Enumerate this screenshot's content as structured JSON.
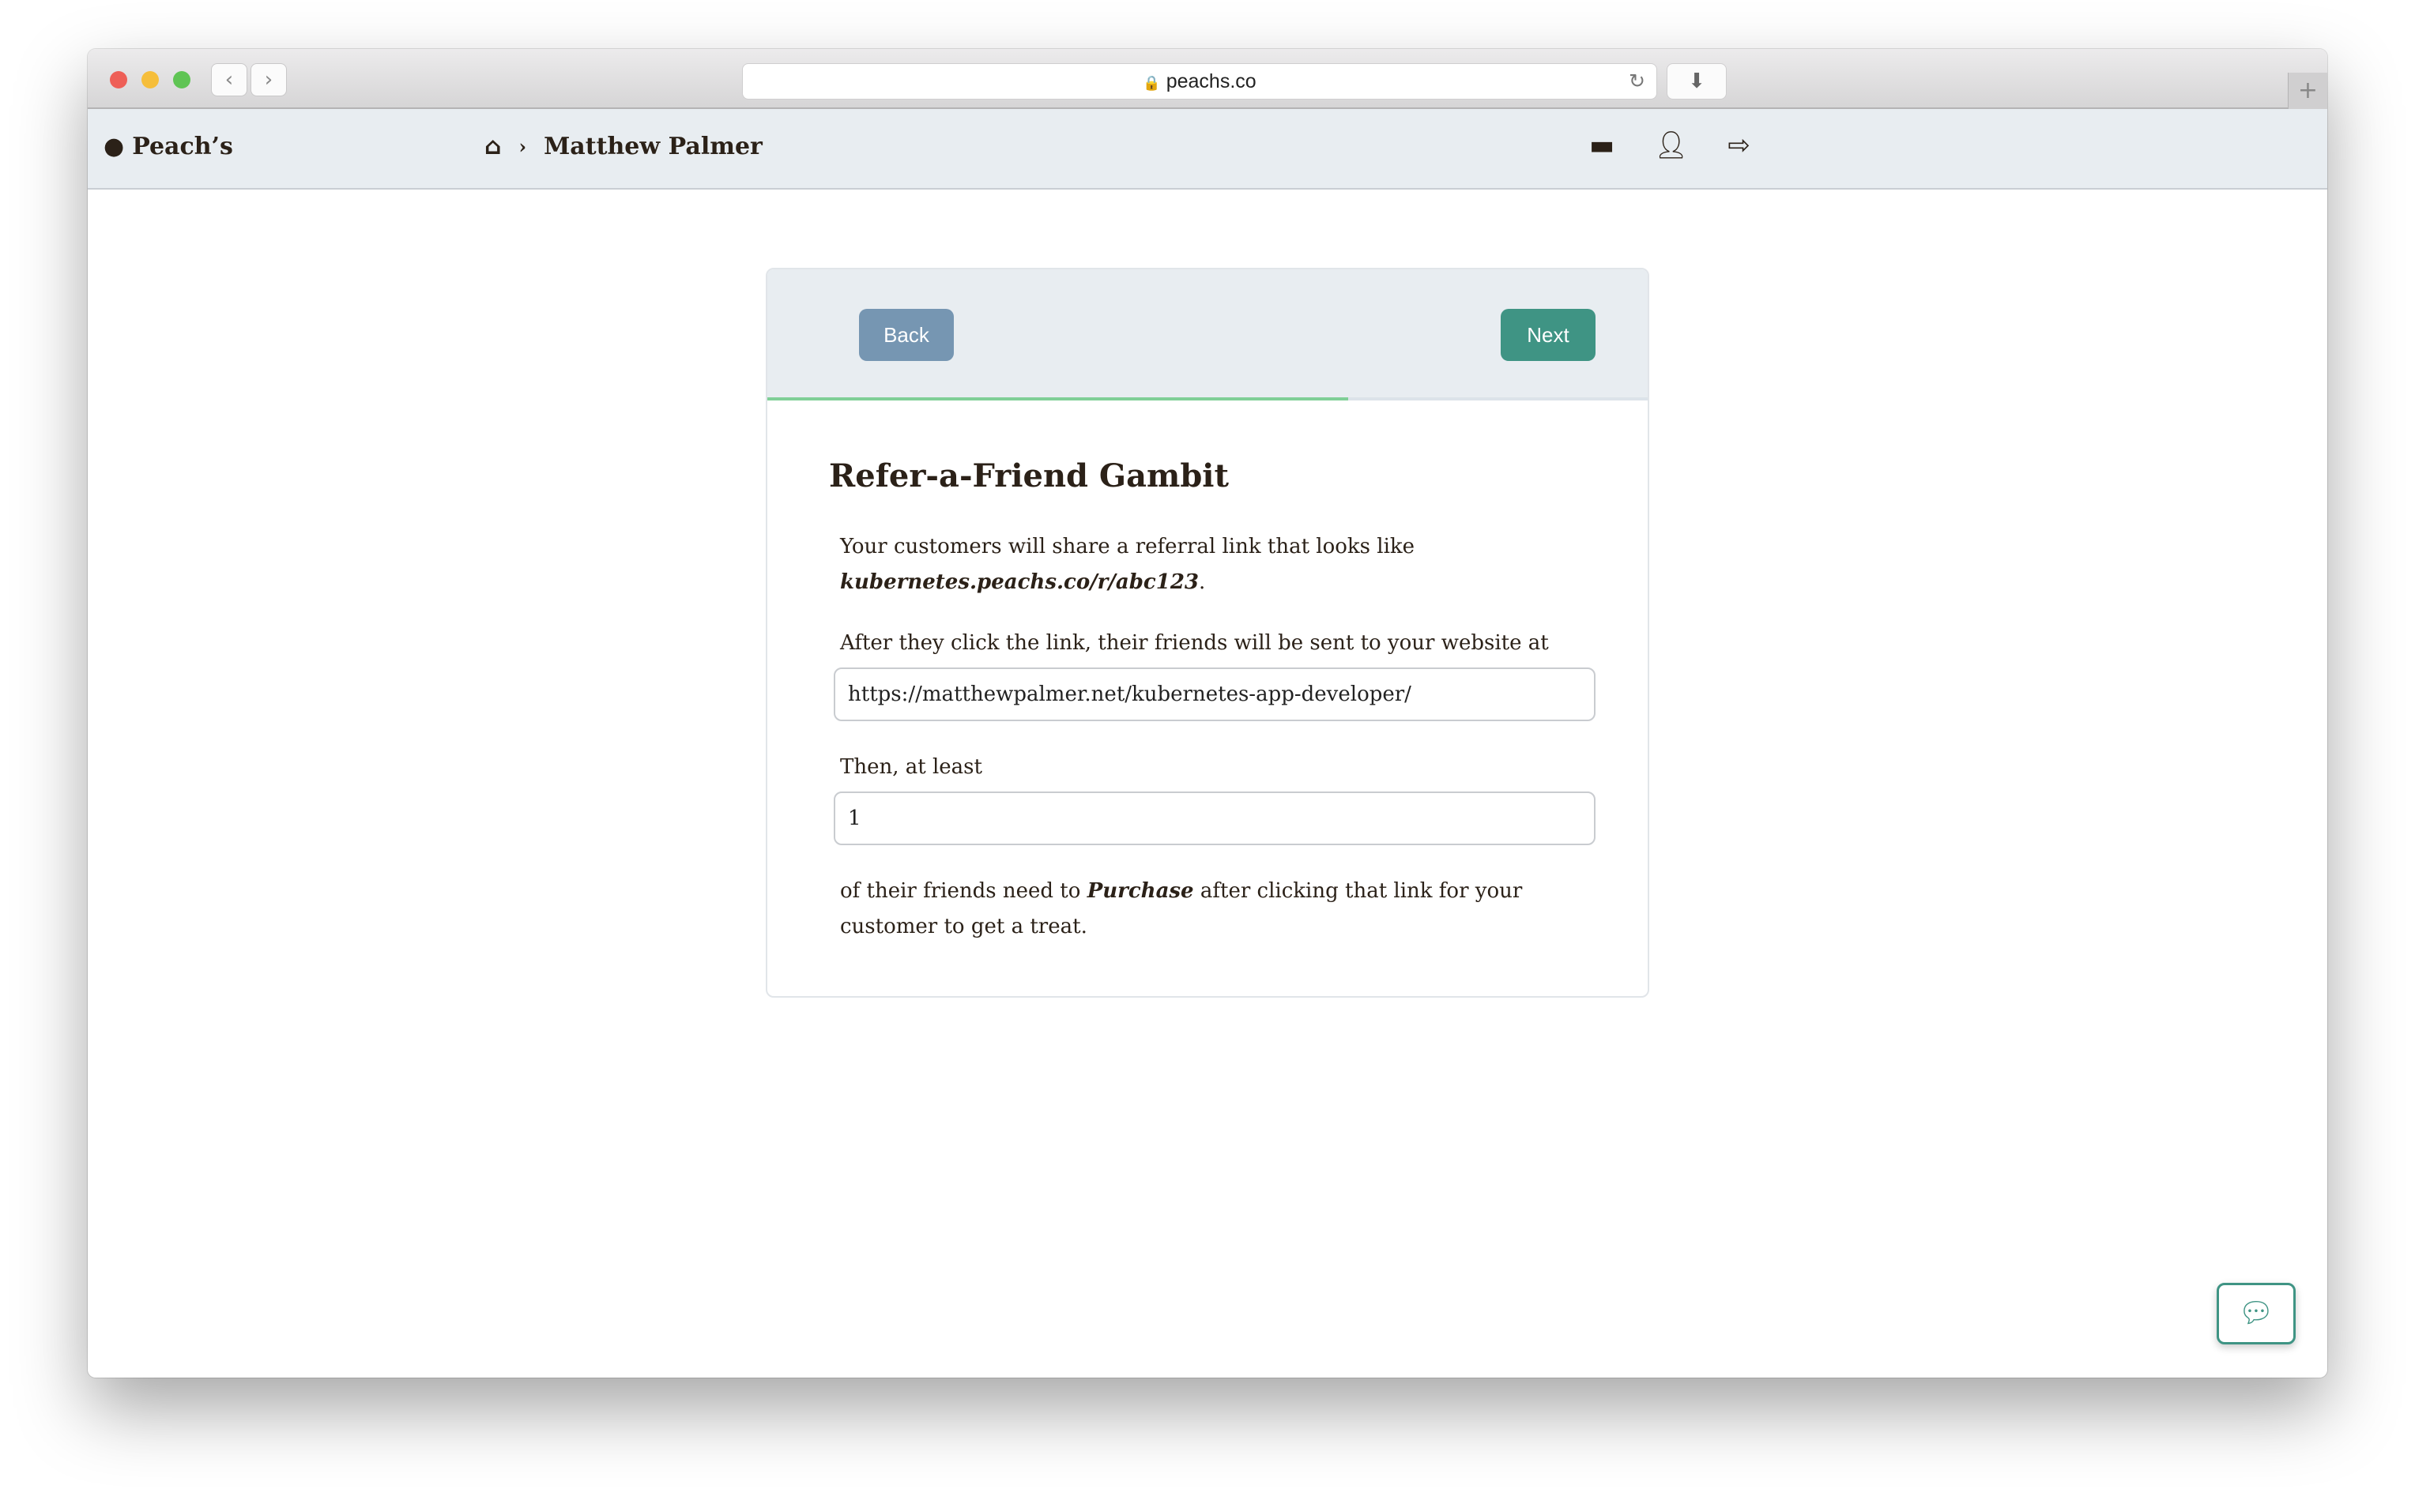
{
  "browser": {
    "url": "peachs.co",
    "back_icon": "chevron-left-icon",
    "forward_icon": "chevron-right-icon"
  },
  "nav": {
    "brand": "Peach’s",
    "breadcrumb_current": "Matthew Palmer",
    "icons": [
      "credit-card-icon",
      "user-icon",
      "sign-out-icon"
    ]
  },
  "wizard": {
    "back_label": "Back",
    "next_label": "Next",
    "progress_percent": 66,
    "title": "Refer-a-Friend Gambit",
    "intro_text": "Your customers will share a referral link that looks like",
    "example_link": "kubernetes.peachs.co/r/abc123",
    "intro_end": ".",
    "redirect_label": "After they click the link, their friends will be sent to your website at",
    "redirect_value": "https://matthewpalmer.net/kubernetes-app-developer/",
    "count_label": "Then, at least",
    "count_value": "1",
    "outro_pre": "of their friends need to ",
    "outro_action": "Purchase",
    "outro_post": " after clicking that link for your customer to get a treat."
  },
  "colors": {
    "accent": "#3f9484",
    "back_button": "#7696b2",
    "progress": "#7fcf97",
    "nav_bg": "#e8edf1"
  }
}
